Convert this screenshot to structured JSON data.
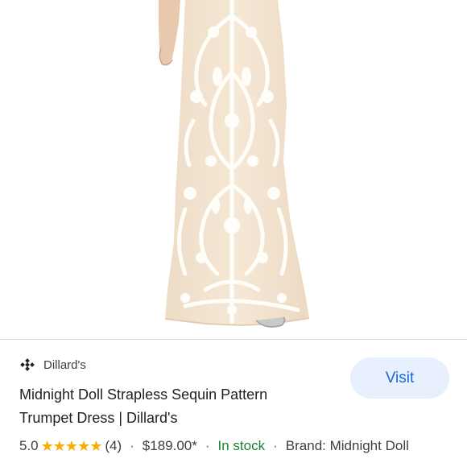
{
  "source": {
    "name": "Dillard's",
    "icon": "dillards-logo-icon"
  },
  "visit_button": {
    "label": "Visit",
    "color": "#1967d2",
    "background": "#e8f0fe"
  },
  "product": {
    "title_line1": "Midnight Doll Strapless Sequin Pattern",
    "title_line2": "Trumpet Dress | Dillard's",
    "rating": "5.0",
    "stars": "★★★★★",
    "review_count": "(4)",
    "price": "$189.00*",
    "availability": "In stock",
    "brand": "Brand: Midnight Doll",
    "separator": "·"
  },
  "colors": {
    "stars": "#f9ab00",
    "in_stock": "#188038",
    "dress_base": "#f3e4d2",
    "dress_lace": "#fdfaf4"
  }
}
